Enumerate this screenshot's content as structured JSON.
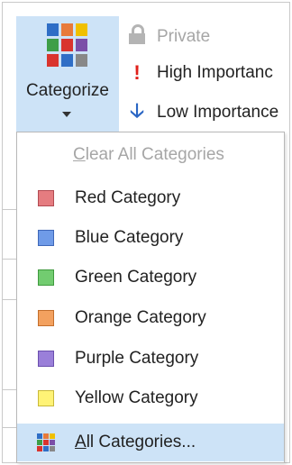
{
  "ribbon": {
    "categorize_label": "Categorize",
    "private_label": "Private",
    "high_importance_label": "High Importanc",
    "low_importance_label": "Low Importance",
    "high_icon": "exclamation-icon",
    "low_icon": "down-arrow-icon"
  },
  "menu": {
    "clear_access_key": "C",
    "clear_rest": "lear All Categories",
    "items": [
      {
        "label": "Red Category",
        "color": "#e57c80",
        "border": "#b24b52"
      },
      {
        "label": "Blue Category",
        "color": "#6f9be8",
        "border": "#3f68b8"
      },
      {
        "label": "Green Category",
        "color": "#72cc70",
        "border": "#3f9a3e"
      },
      {
        "label": "Orange Category",
        "color": "#f3a15f",
        "border": "#c36e2c"
      },
      {
        "label": "Purple Category",
        "color": "#9a7fd9",
        "border": "#6b4fae"
      },
      {
        "label": "Yellow Category",
        "color": "#fff376",
        "border": "#c9b93a"
      }
    ],
    "all_access_key": "A",
    "all_rest": "ll Categories..."
  },
  "colors": {
    "selected_bg": "#cde3f7",
    "disabled_text": "#a6a6a6",
    "high_importance": "#e0201a",
    "low_importance": "#2a66c4"
  }
}
